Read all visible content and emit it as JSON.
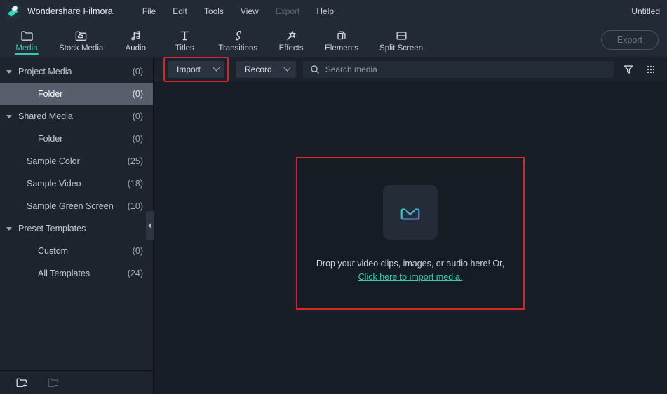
{
  "titlebar": {
    "logo_icon": "filmora-logo-icon",
    "app_name": "Wondershare Filmora",
    "project_title": "Untitled",
    "menus": [
      {
        "label": "File",
        "disabled": false
      },
      {
        "label": "Edit",
        "disabled": false
      },
      {
        "label": "Tools",
        "disabled": false
      },
      {
        "label": "View",
        "disabled": false
      },
      {
        "label": "Export",
        "disabled": true
      },
      {
        "label": "Help",
        "disabled": false
      }
    ]
  },
  "ribbon": {
    "accent_color": "#34c9b6",
    "tabs": [
      {
        "label": "Media",
        "icon": "folder-icon",
        "active": true
      },
      {
        "label": "Stock Media",
        "icon": "cloud-folder-icon",
        "active": false
      },
      {
        "label": "Audio",
        "icon": "music-note-icon",
        "active": false
      },
      {
        "label": "Titles",
        "icon": "text-t-icon",
        "active": false
      },
      {
        "label": "Transitions",
        "icon": "transition-arrow-icon",
        "active": false
      },
      {
        "label": "Effects",
        "icon": "sparkle-star-icon",
        "active": false
      },
      {
        "label": "Elements",
        "icon": "stacked-shapes-icon",
        "active": false
      },
      {
        "label": "Split Screen",
        "icon": "split-screen-icon",
        "active": false
      }
    ],
    "export_button": "Export"
  },
  "sidebar": {
    "items": [
      {
        "label": "Project Media",
        "count": "(0)",
        "level": 0,
        "caret": true,
        "selected": false
      },
      {
        "label": "Folder",
        "count": "(0)",
        "level": 2,
        "caret": false,
        "selected": true
      },
      {
        "label": "Shared Media",
        "count": "(0)",
        "level": 0,
        "caret": true,
        "selected": false
      },
      {
        "label": "Folder",
        "count": "(0)",
        "level": 2,
        "caret": false,
        "selected": false
      },
      {
        "label": "Sample Color",
        "count": "(25)",
        "level": 1,
        "caret": false,
        "selected": false
      },
      {
        "label": "Sample Video",
        "count": "(18)",
        "level": 1,
        "caret": false,
        "selected": false
      },
      {
        "label": "Sample Green Screen",
        "count": "(10)",
        "level": 1,
        "caret": false,
        "selected": false
      },
      {
        "label": "Preset Templates",
        "count": "",
        "level": 0,
        "caret": true,
        "selected": false
      },
      {
        "label": "Custom",
        "count": "(0)",
        "level": 2,
        "caret": false,
        "selected": false
      },
      {
        "label": "All Templates",
        "count": "(24)",
        "level": 2,
        "caret": false,
        "selected": false
      }
    ],
    "footer": {
      "new_folder_icon": "folder-add-icon",
      "remove_folder_icon": "folder-remove-icon"
    },
    "collapse_icon": "collapse-left-icon"
  },
  "toolbar": {
    "import_label": "Import",
    "import_caret_icon": "chevron-down-icon",
    "record_label": "Record",
    "record_caret_icon": "chevron-down-icon",
    "search_icon": "search-icon",
    "search_placeholder": "Search media",
    "search_value": "",
    "filter_icon": "filter-funnel-icon",
    "grid_view_icon": "grid-view-icon",
    "highlight_color": "#d9252a"
  },
  "dropzone": {
    "import_icon": "import-download-icon",
    "line1": "Drop your video clips, images, or audio here! Or,",
    "link": "Click here to import media.",
    "link_color": "#3fc8b4",
    "border_color": "#d9252a"
  }
}
